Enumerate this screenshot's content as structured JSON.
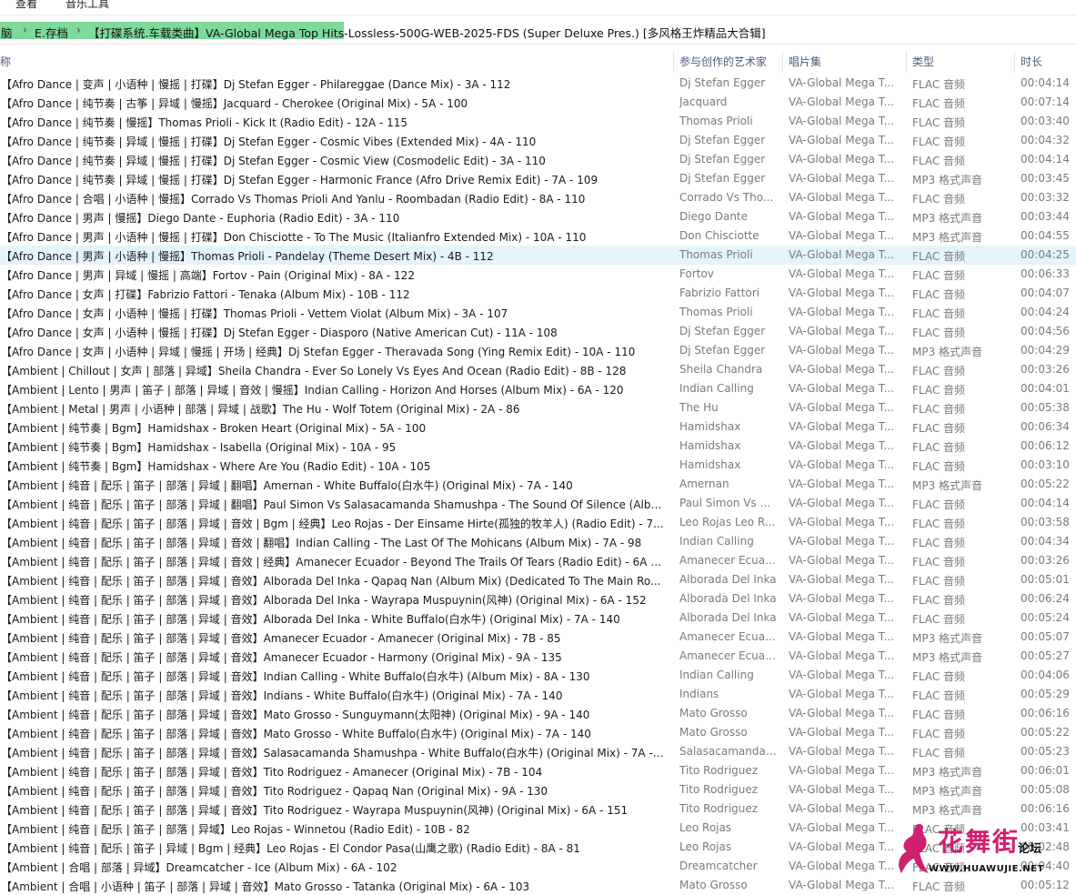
{
  "menu": {
    "view": "查看",
    "music_tools": "音乐工具"
  },
  "breadcrumb": {
    "items": [
      "脑",
      "E.存档",
      "【打碟系统.车载类曲】VA-Global Mega Top Hits-Lossless-500G-WEB-2025-FDS (Super Deluxe Pres.) [多风格王炸精品大合辑]"
    ],
    "sep": "›"
  },
  "columns": {
    "name": "称",
    "artist": "参与创作的艺术家",
    "album": "唱片集",
    "type": "类型",
    "duration": "时长"
  },
  "rows": [
    {
      "name": "【Afro Dance | 变声 | 小语种 | 慢摇 | 打碟】Dj Stefan Egger - Philareggae (Dance Mix) - 3A - 112",
      "artist": "Dj Stefan Egger",
      "album": "VA-Global Mega T...",
      "type": "FLAC 音频",
      "duration": "00:04:14"
    },
    {
      "name": "【Afro Dance | 纯节奏 | 古筝 | 异域 | 慢摇】Jacquard - Cherokee (Original Mix) - 5A - 100",
      "artist": "Jacquard",
      "album": "VA-Global Mega T...",
      "type": "FLAC 音频",
      "duration": "00:07:14"
    },
    {
      "name": "【Afro Dance | 纯节奏 | 慢摇】Thomas Prioli - Kick It (Radio Edit) - 12A - 115",
      "artist": "Thomas Prioli",
      "album": "VA-Global Mega T...",
      "type": "FLAC 音频",
      "duration": "00:03:40"
    },
    {
      "name": "【Afro Dance | 纯节奏 | 异域 | 慢摇 | 打碟】Dj Stefan Egger - Cosmic Vibes (Extended Mix) - 4A - 110",
      "artist": "Dj Stefan Egger",
      "album": "VA-Global Mega T...",
      "type": "FLAC 音频",
      "duration": "00:04:32"
    },
    {
      "name": "【Afro Dance | 纯节奏 | 异域 | 慢摇 | 打碟】Dj Stefan Egger - Cosmic View (Cosmodelic Edit) - 3A - 110",
      "artist": "Dj Stefan Egger",
      "album": "VA-Global Mega T...",
      "type": "FLAC 音频",
      "duration": "00:04:14"
    },
    {
      "name": "【Afro Dance | 纯节奏 | 异域 | 慢摇 | 打碟】Dj Stefan Egger - Harmonic France (Afro Drive Remix Edit) - 7A - 109",
      "artist": "Dj Stefan Egger",
      "album": "VA-Global Mega T...",
      "type": "MP3 格式声音",
      "duration": "00:03:45"
    },
    {
      "name": "【Afro Dance | 合唱 | 小语种 | 慢摇】Corrado Vs Thomas Prioli And Yanlu - Roombadan (Radio Edit) - 8A - 110",
      "artist": "Corrado Vs Tho...",
      "album": "VA-Global Mega T...",
      "type": "FLAC 音频",
      "duration": "00:03:32"
    },
    {
      "name": "【Afro Dance | 男声 | 慢摇】Diego Dante - Euphoria (Radio Edit) - 3A - 110",
      "artist": "Diego Dante",
      "album": "VA-Global Mega T...",
      "type": "MP3 格式声音",
      "duration": "00:03:44"
    },
    {
      "name": "【Afro Dance | 男声 | 小语种 | 慢摇 | 打碟】Don Chisciotte - To The Music (Italianfro Extended Mix) - 10A - 110",
      "artist": "Don Chisciotte",
      "album": "VA-Global Mega T...",
      "type": "MP3 格式声音",
      "duration": "00:04:55"
    },
    {
      "name": "【Afro Dance | 男声 | 小语种 | 慢摇】Thomas Prioli - Pandelay (Theme Desert Mix) - 4B - 112",
      "artist": "Thomas Prioli",
      "album": "VA-Global Mega T...",
      "type": "FLAC 音频",
      "duration": "00:04:25"
    },
    {
      "name": "【Afro Dance | 男声 | 异域 | 慢摇 | 高端】Fortov - Pain (Original Mix) - 8A - 122",
      "artist": "Fortov",
      "album": "VA-Global Mega T...",
      "type": "FLAC 音频",
      "duration": "00:06:33"
    },
    {
      "name": "【Afro Dance | 女声 | 打碟】Fabrizio Fattori - Tenaka (Album Mix) - 10B - 112",
      "artist": "Fabrizio Fattori",
      "album": "VA-Global Mega T...",
      "type": "FLAC 音频",
      "duration": "00:04:07"
    },
    {
      "name": "【Afro Dance | 女声 | 小语种 | 慢摇 | 打碟】Thomas Prioli - Vettem Violat (Album Mix) - 3A - 107",
      "artist": "Thomas Prioli",
      "album": "VA-Global Mega T...",
      "type": "FLAC 音频",
      "duration": "00:04:24"
    },
    {
      "name": "【Afro Dance | 女声 | 小语种 | 慢摇 | 打碟】Dj Stefan Egger - Diasporo (Native American Cut) - 11A - 108",
      "artist": "Dj Stefan Egger",
      "album": "VA-Global Mega T...",
      "type": "FLAC 音频",
      "duration": "00:04:56"
    },
    {
      "name": "【Afro Dance | 女声 | 小语种 | 异域 | 慢摇 | 开场 | 经典】Dj Stefan Egger - Theravada Song (Ying Remix Edit) - 10A - 110",
      "artist": "Dj Stefan Egger",
      "album": "VA-Global Mega T...",
      "type": "MP3 格式声音",
      "duration": "00:04:29"
    },
    {
      "name": "【Ambient | Chillout | 女声 | 部落 | 异域】Sheila Chandra - Ever So Lonely Vs Eyes And Ocean (Radio Edit) - 8B - 128",
      "artist": "Sheila Chandra",
      "album": "VA-Global Mega T...",
      "type": "FLAC 音频",
      "duration": "00:03:26"
    },
    {
      "name": "【Ambient | Lento | 男声 | 笛子 | 部落 | 异域 | 音效 | 慢摇】Indian Calling - Horizon And Horses (Album Mix) - 6A - 120",
      "artist": "Indian Calling",
      "album": "VA-Global Mega T...",
      "type": "FLAC 音频",
      "duration": "00:04:01"
    },
    {
      "name": "【Ambient | Metal | 男声 | 小语种 | 部落 | 异域 | 战歌】The Hu - Wolf Totem (Original Mix) - 2A - 86",
      "artist": "The Hu",
      "album": "VA-Global Mega T...",
      "type": "FLAC 音频",
      "duration": "00:05:38"
    },
    {
      "name": "【Ambient | 纯节奏 | Bgm】Hamidshax - Broken Heart (Original Mix) - 5A - 100",
      "artist": "Hamidshax",
      "album": "VA-Global Mega T...",
      "type": "FLAC 音频",
      "duration": "00:06:34"
    },
    {
      "name": "【Ambient | 纯节奏 | Bgm】Hamidshax - Isabella (Original Mix) - 10A - 95",
      "artist": "Hamidshax",
      "album": "VA-Global Mega T...",
      "type": "FLAC 音频",
      "duration": "00:06:12"
    },
    {
      "name": "【Ambient | 纯节奏 | Bgm】Hamidshax - Where Are You (Radio Edit) - 10A - 105",
      "artist": "Hamidshax",
      "album": "VA-Global Mega T...",
      "type": "FLAC 音频",
      "duration": "00:03:10"
    },
    {
      "name": "【Ambient | 纯音 | 配乐 | 笛子 | 部落 | 异域 | 翻唱】Amernan - White Buffalo(白水牛) (Original Mix) - 7A - 140",
      "artist": "Amernan",
      "album": "VA-Global Mega T...",
      "type": "MP3 格式声音",
      "duration": "00:05:22"
    },
    {
      "name": "【Ambient | 纯音 | 配乐 | 笛子 | 部落 | 异域 | 翻唱】Paul Simon Vs Salasacamanda Shamushpa - The Sound Of Silence (Albu...",
      "artist": "Paul Simon Vs S...",
      "album": "VA-Global Mega T...",
      "type": "FLAC 音频",
      "duration": "00:04:14"
    },
    {
      "name": "【Ambient | 纯音 | 配乐 | 笛子 | 部落 | 异域 | 音效 | Bgm | 经典】Leo Rojas - Der Einsame Hirte(孤独的牧羊人) (Radio Edit) - 7...",
      "artist": "Leo Rojas Leo R...",
      "album": "VA-Global Mega T...",
      "type": "FLAC 音频",
      "duration": "00:03:58"
    },
    {
      "name": "【Ambient | 纯音 | 配乐 | 笛子 | 部落 | 异域 | 音效 | 翻唱】Indian Calling - The Last Of The Mohicans (Album Mix) - 7A - 98",
      "artist": "Indian Calling",
      "album": "VA-Global Mega T...",
      "type": "FLAC 音频",
      "duration": "00:04:34"
    },
    {
      "name": "【Ambient | 纯音 | 配乐 | 笛子 | 部落 | 异域 | 音效 | 经典】Amanecer Ecuador - Beyond The Trails Of Tears (Radio Edit) - 6A - ...",
      "artist": "Amanecer Ecuad...",
      "album": "VA-Global Mega T...",
      "type": "FLAC 音频",
      "duration": "00:03:26"
    },
    {
      "name": "【Ambient | 纯音 | 配乐 | 笛子 | 部落 | 异域 | 音效】Alborada Del Inka - Qapaq Nan (Album Mix) (Dedicated To The Main Ro...",
      "artist": "Alborada Del Inka",
      "album": "VA-Global Mega T...",
      "type": "FLAC 音频",
      "duration": "00:05:01"
    },
    {
      "name": "【Ambient | 纯音 | 配乐 | 笛子 | 部落 | 异域 | 音效】Alborada Del Inka - Wayrapa Muspuynin(风神) (Original Mix) - 6A - 152",
      "artist": "Alborada Del Inka",
      "album": "VA-Global Mega T...",
      "type": "FLAC 音频",
      "duration": "00:06:24"
    },
    {
      "name": "【Ambient | 纯音 | 配乐 | 笛子 | 部落 | 异域 | 音效】Alborada Del Inka - White Buffalo(白水牛) (Original Mix) - 7A - 140",
      "artist": "Alborada Del Inka",
      "album": "VA-Global Mega T...",
      "type": "FLAC 音频",
      "duration": "00:05:24"
    },
    {
      "name": "【Ambient | 纯音 | 配乐 | 笛子 | 部落 | 异域 | 音效】Amanecer Ecuador - Amanecer (Original Mix) - 7B - 85",
      "artist": "Amanecer Ecuad...",
      "album": "VA-Global Mega T...",
      "type": "MP3 格式声音",
      "duration": "00:05:07"
    },
    {
      "name": "【Ambient | 纯音 | 配乐 | 笛子 | 部落 | 异域 | 音效】Amanecer Ecuador - Harmony (Original Mix) - 9A - 135",
      "artist": "Amanecer Ecuad...",
      "album": "VA-Global Mega T...",
      "type": "MP3 格式声音",
      "duration": "00:05:27"
    },
    {
      "name": "【Ambient | 纯音 | 配乐 | 笛子 | 部落 | 异域 | 音效】Indian Calling - White Buffalo(白水牛) (Album Mix) - 8A - 130",
      "artist": "Indian Calling",
      "album": "VA-Global Mega T...",
      "type": "FLAC 音频",
      "duration": "00:04:06"
    },
    {
      "name": "【Ambient | 纯音 | 配乐 | 笛子 | 部落 | 异域 | 音效】Indians - White Buffalo(白水牛) (Original Mix) - 7A - 140",
      "artist": "Indians",
      "album": "VA-Global Mega T...",
      "type": "FLAC 音频",
      "duration": "00:05:29"
    },
    {
      "name": "【Ambient | 纯音 | 配乐 | 笛子 | 部落 | 异域 | 音效】Mato Grosso - Sunguymann(太阳神) (Original Mix) - 9A - 140",
      "artist": "Mato Grosso",
      "album": "VA-Global Mega T...",
      "type": "FLAC 音频",
      "duration": "00:06:16"
    },
    {
      "name": "【Ambient | 纯音 | 配乐 | 笛子 | 部落 | 异域 | 音效】Mato Grosso - White Buffalo(白水牛) (Original Mix) - 7A - 140",
      "artist": "Mato Grosso",
      "album": "VA-Global Mega T...",
      "type": "FLAC 音频",
      "duration": "00:05:22"
    },
    {
      "name": "【Ambient | 纯音 | 配乐 | 笛子 | 部落 | 异域 | 音效】Salasacamanda Shamushpa - White Buffalo(白水牛) (Original Mix) - 7A - 1...",
      "artist": "Salasacamanda ...",
      "album": "VA-Global Mega T...",
      "type": "FLAC 音频",
      "duration": "00:05:23"
    },
    {
      "name": "【Ambient | 纯音 | 配乐 | 笛子 | 部落 | 异域 | 音效】Tito Rodriguez - Amanecer (Original Mix) - 7B - 104",
      "artist": "Tito Rodriguez",
      "album": "VA-Global Mega T...",
      "type": "MP3 格式声音",
      "duration": "00:06:01"
    },
    {
      "name": "【Ambient | 纯音 | 配乐 | 笛子 | 部落 | 异域 | 音效】Tito Rodriguez - Qapaq Nan (Original Mix) - 9A - 130",
      "artist": "Tito Rodriguez",
      "album": "VA-Global Mega T...",
      "type": "MP3 格式声音",
      "duration": "00:05:08"
    },
    {
      "name": "【Ambient | 纯音 | 配乐 | 笛子 | 部落 | 异域 | 音效】Tito Rodriguez - Wayrapa Muspuynin(风神) (Original Mix) - 6A - 151",
      "artist": "Tito Rodriguez",
      "album": "VA-Global Mega T...",
      "type": "MP3 格式声音",
      "duration": "00:06:16"
    },
    {
      "name": "【Ambient | 纯音 | 配乐 | 笛子 | 部落 | 异域】Leo Rojas - Winnetou (Radio Edit) - 10B - 82",
      "artist": "Leo Rojas",
      "album": "VA-Global Mega T...",
      "type": "FLAC 音频",
      "duration": "00:03:41"
    },
    {
      "name": "【Ambient | 纯音 | 配乐 | 笛子 | 异域 | Bgm | 经典】Leo Rojas - El Condor Pasa(山鹰之歌) (Radio Edit) - 8A - 81",
      "artist": "Leo Rojas",
      "album": "VA-Global Mega T...",
      "type": "FLAC 音频",
      "duration": "00:02:48"
    },
    {
      "name": "【Ambient | 合唱 | 部落 | 异域】Dreamcatcher - Ice (Album Mix) - 6A - 102",
      "artist": "Dreamcatcher",
      "album": "VA-Global Mega T...",
      "type": "FLAC 音频",
      "duration": "00:04:40"
    },
    {
      "name": "【Ambient | 合唱 | 小语种 | 笛子 | 部落 | 异域 | 音效】Mato Grosso - Tatanka (Original Mix) - 6A - 103",
      "artist": "Mato Grosso",
      "album": "VA-Global Mega T...",
      "type": "FLAC 音频",
      "duration": "00:05:12"
    }
  ],
  "selected_index": 9,
  "watermark": {
    "title": "花舞街",
    "tag": "论坛",
    "url": "WWW.HUAWUJIE.NET"
  },
  "colors": {
    "selection": "#e5f3fb",
    "breadcrumb_highlight": "#7ed99a",
    "header_text": "#4c607a",
    "watermark": "#d01f6f"
  }
}
